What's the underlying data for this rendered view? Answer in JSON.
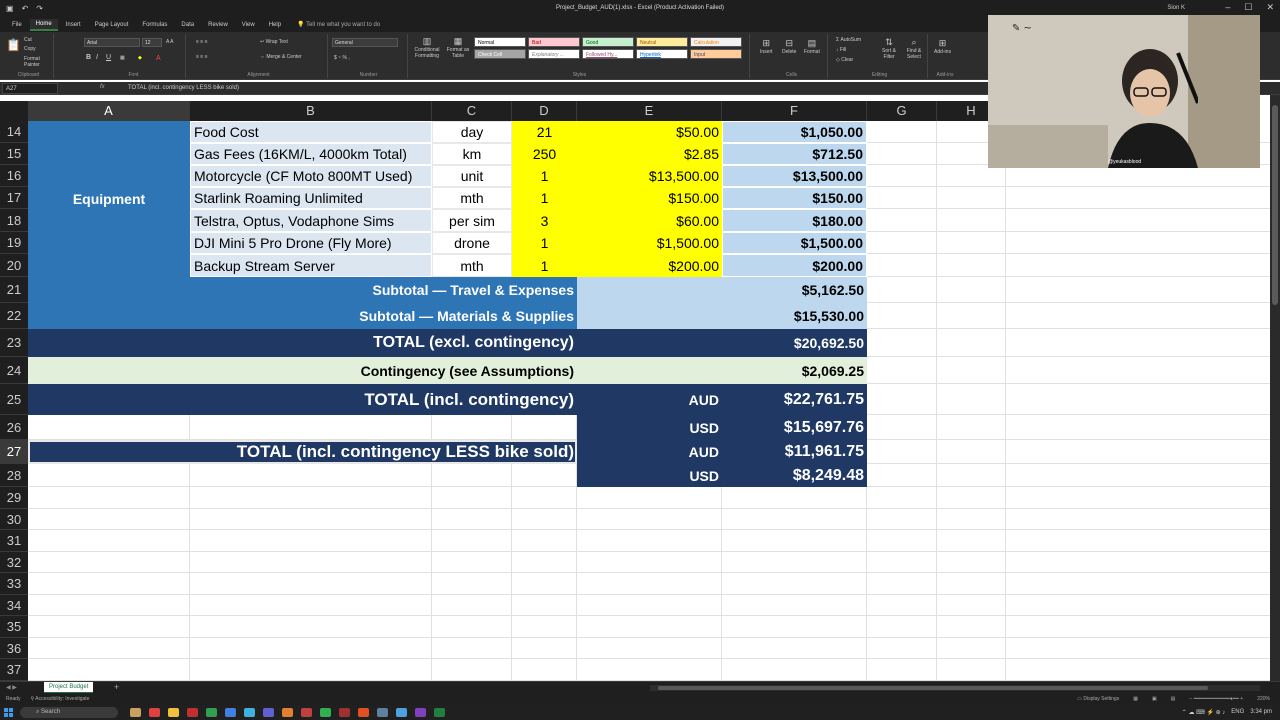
{
  "titlebar": {
    "doc_title": "Project_Budget_AUD(1).xlsx  -  Excel (Product Activation Failed)",
    "user": "Sion K",
    "autosave": "",
    "minimize": "–",
    "maximize": "☐",
    "close": "✕"
  },
  "ribbon_tabs": [
    "File",
    "Home",
    "Insert",
    "Page Layout",
    "Formulas",
    "Data",
    "Review",
    "View",
    "Help"
  ],
  "active_tab": "Home",
  "tell_me": "Tell me what you want to do",
  "ribbon": {
    "clipboard": {
      "label": "Clipboard",
      "cut": "Cut",
      "copy": "Copy",
      "format_painter": "Format Painter"
    },
    "font": {
      "label": "Font",
      "family": "Arial",
      "size": "12"
    },
    "alignment": {
      "label": "Alignment",
      "wrap": "Wrap Text",
      "merge": "Merge & Center"
    },
    "number": {
      "label": "Number",
      "format": "General"
    },
    "styles": {
      "label": "Styles",
      "conditional": "Conditional Formatting",
      "format_as_table": "Format as Table",
      "normal": "Normal",
      "bad": "Bad",
      "good": "Good",
      "neutral": "Neutral",
      "calculation": "Calculation",
      "check_cell": "Check Cell",
      "explanatory": "Explanatory ...",
      "followed": "Followed Hy...",
      "hyperlink": "Hyperlink",
      "input": "Input"
    },
    "cells": {
      "label": "Cells",
      "insert": "Insert",
      "delete": "Delete",
      "format": "Format"
    },
    "editing": {
      "label": "Editing",
      "autosum": "AutoSum",
      "fill": "Fill",
      "clear": "Clear",
      "sort_filter": "Sort & Filter",
      "find_select": "Find & Select"
    },
    "addins": {
      "label": "Add-ins",
      "addins": "Add-ins"
    }
  },
  "formula_bar": {
    "name_box": "A27",
    "fx": "fx",
    "formula": "TOTAL (incl. contingency LESS bike sold)"
  },
  "columns": [
    "A",
    "B",
    "C",
    "D",
    "E",
    "F",
    "G",
    "H"
  ],
  "selected_column": "A",
  "selected_row": 27,
  "rows": [
    14,
    15,
    16,
    17,
    18,
    19,
    20,
    21,
    22,
    23,
    24,
    25,
    26,
    27,
    28,
    29,
    30,
    31,
    32,
    33,
    34,
    35,
    36,
    37
  ],
  "sheet": {
    "category_label": "Equipment",
    "items": [
      {
        "row": 14,
        "item": "Food Cost",
        "unit": "day",
        "qty": "21",
        "price": "$50.00",
        "total": "$1,050.00"
      },
      {
        "row": 15,
        "item": "Gas Fees (16KM/L, 4000km Total)",
        "unit": "km",
        "qty": "250",
        "price": "$2.85",
        "total": "$712.50"
      },
      {
        "row": 16,
        "item": "Motorcycle (CF Moto 800MT Used)",
        "unit": "unit",
        "qty": "1",
        "price": "$13,500.00",
        "total": "$13,500.00"
      },
      {
        "row": 17,
        "item": "Starlink Roaming Unlimited",
        "unit": "mth",
        "qty": "1",
        "price": "$150.00",
        "total": "$150.00"
      },
      {
        "row": 18,
        "item": "Telstra, Optus, Vodaphone Sims",
        "unit": "per sim",
        "qty": "3",
        "price": "$60.00",
        "total": "$180.00"
      },
      {
        "row": 19,
        "item": "DJI Mini 5 Pro Drone (Fly More)",
        "unit": "drone",
        "qty": "1",
        "price": "$1,500.00",
        "total": "$1,500.00"
      },
      {
        "row": 20,
        "item": "Backup Stream Server",
        "unit": "mth",
        "qty": "1",
        "price": "$200.00",
        "total": "$200.00"
      }
    ],
    "subtotal_travel_label": "Subtotal — Travel & Expenses",
    "subtotal_travel_value": "$5,162.50",
    "subtotal_materials_label": "Subtotal — Materials & Supplies",
    "subtotal_materials_value": "$15,530.00",
    "total_excl_label": "TOTAL (excl. contingency)",
    "total_excl_value": "$20,692.50",
    "contingency_label": "Contingency (see Assumptions)",
    "contingency_value": "$2,069.25",
    "total_incl_label": "TOTAL (incl. contingency)",
    "total_incl_aud_cur": "AUD",
    "total_incl_aud_value": "$22,761.75",
    "total_incl_usd_cur": "USD",
    "total_incl_usd_value": "$15,697.76",
    "total_less_label": "TOTAL (incl. contingency LESS bike sold)",
    "total_less_aud_cur": "AUD",
    "total_less_aud_value": "$11,961.75",
    "total_less_usd_cur": "USD",
    "total_less_usd_value": "$8,249.48"
  },
  "sheet_tab": "Project Budget",
  "add_sheet": "+",
  "status": {
    "ready": "Ready",
    "accessibility": "Accessibility: Investigate",
    "display_settings": "Display Settings",
    "zoom": "220%"
  },
  "taskbar": {
    "search": "Search",
    "lang": "ENG",
    "time": "3:34 pm"
  },
  "webcam": {
    "watermark": "@yeukasblood"
  },
  "colors": {
    "blue_mid": "#2e75b6",
    "blue_light": "#dce6f1",
    "navy": "#1f3864",
    "yellow": "#ffff00",
    "green_light": "#e2efda",
    "periwinkle": "#bdd7ee"
  }
}
